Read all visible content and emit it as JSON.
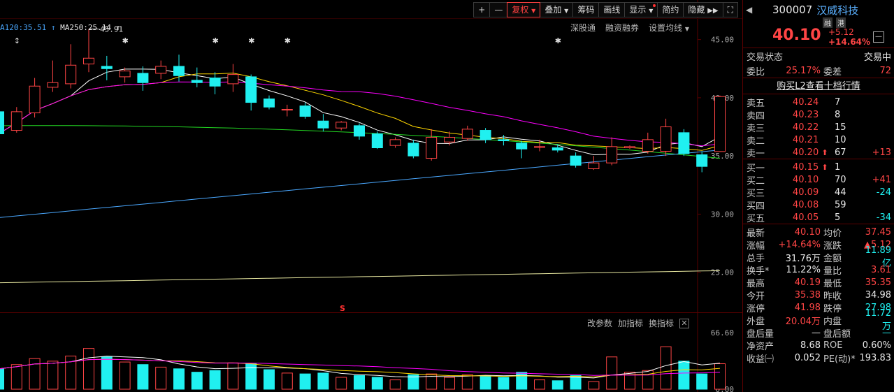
{
  "toolbar": {
    "plus": "+",
    "minus": "—",
    "fuquan": "复权",
    "diejia": "叠加",
    "chouma": "筹码",
    "huaxian": "画线",
    "xianshi": "显示",
    "jianyue": "简约",
    "yincang": "隐藏"
  },
  "ma_legend": {
    "ma120": "A120:35.51",
    "ma250": "MA250:25.14"
  },
  "sub_links": {
    "shengutong": "深股通",
    "rongzi": "融资融券",
    "settings": "设置均线"
  },
  "vol_links": {
    "gaicanshu": "改参数",
    "jiazhibiao": "加指标",
    "huanzhibiao": "换指标",
    "close": "✕"
  },
  "annotations": {
    "high_label": "45.91",
    "s_mark": "S"
  },
  "chart_data": {
    "type": "candlestick",
    "y_ticks": [
      "45.00",
      "40.00",
      "35.00",
      "30.00",
      "25.00"
    ],
    "vol_ticks": [
      "66.60",
      "0.00"
    ],
    "ylim": [
      21.5,
      48.4
    ],
    "vol_max": 66.6,
    "candles": [
      {
        "o": 38.8,
        "c": 36.9,
        "h": 39.0,
        "l": 36.6,
        "v": 24
      },
      {
        "o": 37.2,
        "c": 38.8,
        "h": 39.2,
        "l": 37.0,
        "v": 29
      },
      {
        "o": 38.7,
        "c": 41.0,
        "h": 41.7,
        "l": 38.3,
        "v": 36
      },
      {
        "o": 40.9,
        "c": 41.3,
        "h": 43.2,
        "l": 40.5,
        "v": 33
      },
      {
        "o": 41.2,
        "c": 42.8,
        "h": 44.6,
        "l": 40.8,
        "v": 39
      },
      {
        "o": 42.9,
        "c": 43.4,
        "h": 45.91,
        "l": 42.2,
        "v": 48
      },
      {
        "o": 42.7,
        "c": 42.5,
        "h": 43.6,
        "l": 41.5,
        "v": 38
      },
      {
        "o": 41.8,
        "c": 42.3,
        "h": 42.6,
        "l": 41.3,
        "v": 32
      },
      {
        "o": 42.1,
        "c": 41.3,
        "h": 42.7,
        "l": 40.6,
        "v": 29
      },
      {
        "o": 42.1,
        "c": 42.7,
        "h": 43.2,
        "l": 41.6,
        "v": 26
      },
      {
        "o": 42.7,
        "c": 41.9,
        "h": 43.7,
        "l": 41.4,
        "v": 24
      },
      {
        "o": 41.5,
        "c": 41.3,
        "h": 42.6,
        "l": 40.9,
        "v": 20
      },
      {
        "o": 41.7,
        "c": 41.0,
        "h": 42.2,
        "l": 40.3,
        "v": 22
      },
      {
        "o": 41.2,
        "c": 42.0,
        "h": 42.9,
        "l": 40.5,
        "v": 31
      },
      {
        "o": 41.8,
        "c": 39.6,
        "h": 42.0,
        "l": 38.9,
        "v": 30
      },
      {
        "o": 39.9,
        "c": 39.2,
        "h": 40.2,
        "l": 39.0,
        "v": 23
      },
      {
        "o": 39.0,
        "c": 39.0,
        "h": 39.4,
        "l": 38.4,
        "v": 19
      },
      {
        "o": 39.3,
        "c": 38.4,
        "h": 39.6,
        "l": 38.2,
        "v": 18
      },
      {
        "o": 38.0,
        "c": 37.4,
        "h": 38.6,
        "l": 37.1,
        "v": 19
      },
      {
        "o": 37.4,
        "c": 37.9,
        "h": 38.0,
        "l": 37.2,
        "v": 14
      },
      {
        "o": 37.6,
        "c": 36.7,
        "h": 37.8,
        "l": 36.4,
        "v": 16
      },
      {
        "o": 36.9,
        "c": 35.7,
        "h": 37.1,
        "l": 35.6,
        "v": 14
      },
      {
        "o": 35.9,
        "c": 36.4,
        "h": 36.6,
        "l": 35.7,
        "v": 11
      },
      {
        "o": 36.1,
        "c": 35.0,
        "h": 36.4,
        "l": 34.8,
        "v": 17
      },
      {
        "o": 34.8,
        "c": 36.6,
        "h": 37.3,
        "l": 34.6,
        "v": 18
      },
      {
        "o": 36.2,
        "c": 36.6,
        "h": 37.1,
        "l": 35.9,
        "v": 14
      },
      {
        "o": 36.5,
        "c": 37.3,
        "h": 37.6,
        "l": 36.3,
        "v": 17
      },
      {
        "o": 37.2,
        "c": 36.4,
        "h": 37.4,
        "l": 36.1,
        "v": 16
      },
      {
        "o": 36.4,
        "c": 36.3,
        "h": 36.8,
        "l": 35.9,
        "v": 14
      },
      {
        "o": 36.1,
        "c": 35.6,
        "h": 36.3,
        "l": 34.8,
        "v": 20
      },
      {
        "o": 35.8,
        "c": 35.8,
        "h": 36.4,
        "l": 35.4,
        "v": 11
      },
      {
        "o": 35.7,
        "c": 35.5,
        "h": 36.0,
        "l": 35.3,
        "v": 10
      },
      {
        "o": 35.0,
        "c": 34.2,
        "h": 35.3,
        "l": 34.0,
        "v": 16
      },
      {
        "o": 33.9,
        "c": 34.4,
        "h": 35.0,
        "l": 33.8,
        "v": 9
      },
      {
        "o": 34.4,
        "c": 35.8,
        "h": 36.6,
        "l": 34.2,
        "v": 38
      },
      {
        "o": 35.7,
        "c": 35.8,
        "h": 35.9,
        "l": 35.6,
        "v": 20
      },
      {
        "o": 35.4,
        "c": 36.4,
        "h": 37.0,
        "l": 35.2,
        "v": 22
      },
      {
        "o": 35.4,
        "c": 37.5,
        "h": 38.2,
        "l": 35.0,
        "v": 50
      },
      {
        "o": 37.0,
        "c": 35.2,
        "h": 37.3,
        "l": 35.0,
        "v": 33
      },
      {
        "o": 35.1,
        "c": 34.1,
        "h": 35.4,
        "l": 33.6,
        "v": 18
      },
      {
        "o": 35.38,
        "c": 40.1,
        "h": 40.19,
        "l": 35.35,
        "v": 30
      }
    ]
  },
  "quote": {
    "code": "300007",
    "name": "汉威科技",
    "tag1": "融",
    "tag2": "港",
    "price": "40.10",
    "change": "+5.12",
    "change_pct": "+14.64%",
    "minus_btn": "—",
    "trade_status_label": "交易状态",
    "trade_status_value": "交易中",
    "weibi_label": "委比",
    "weibi_value": "25.17%",
    "weicha_label": "委差",
    "weicha_value": "72",
    "l2_link": "购买L2查看十档行情",
    "asks": [
      {
        "label": "卖五",
        "price": "40.24",
        "vol": "7",
        "delta": ""
      },
      {
        "label": "卖四",
        "price": "40.23",
        "vol": "8",
        "delta": ""
      },
      {
        "label": "卖三",
        "price": "40.22",
        "vol": "15",
        "delta": ""
      },
      {
        "label": "卖二",
        "price": "40.21",
        "vol": "10",
        "delta": ""
      },
      {
        "label": "卖一",
        "price": "40.20",
        "arrow": "⬆",
        "vol": "67",
        "delta": "+13"
      }
    ],
    "bids": [
      {
        "label": "买一",
        "price": "40.15",
        "arrow": "⬆",
        "vol": "1",
        "delta": ""
      },
      {
        "label": "买二",
        "price": "40.10",
        "vol": "70",
        "delta": "+41"
      },
      {
        "label": "买三",
        "price": "40.09",
        "vol": "44",
        "delta": "-24"
      },
      {
        "label": "买四",
        "price": "40.08",
        "vol": "59",
        "delta": ""
      },
      {
        "label": "买五",
        "price": "40.05",
        "vol": "5",
        "delta": "-34"
      }
    ],
    "stats": [
      {
        "l1": "最新",
        "v1": "40.10",
        "c1": "red",
        "l2": "均价",
        "v2": "37.45",
        "c2": "red"
      },
      {
        "l1": "涨幅",
        "v1": "+14.64%",
        "c1": "red",
        "l2": "涨跌",
        "v2": "▲5.12",
        "c2": "red"
      },
      {
        "l1": "总手",
        "v1": "31.76万",
        "c1": "white",
        "l2": "金额",
        "v2": "11.89亿",
        "c2": "cyan"
      },
      {
        "l1": "换手*",
        "v1": "11.22%",
        "c1": "white",
        "l2": "量比",
        "v2": "3.61",
        "c2": "red"
      },
      {
        "l1": "最高",
        "v1": "40.19",
        "c1": "red",
        "l2": "最低",
        "v2": "35.35",
        "c2": "red"
      },
      {
        "l1": "今开",
        "v1": "35.38",
        "c1": "red",
        "l2": "昨收",
        "v2": "34.98",
        "c2": "white"
      },
      {
        "l1": "涨停",
        "v1": "41.98",
        "c1": "red",
        "l2": "跌停",
        "v2": "27.98",
        "c2": "cyan"
      },
      {
        "l1": "外盘",
        "v1": "20.04万",
        "c1": "red",
        "l2": "内盘",
        "v2": "11.72万",
        "c2": "cyan"
      },
      {
        "l1": "盘后量",
        "v1": "—",
        "c1": "white",
        "l2": "盘后额",
        "v2": "—",
        "c2": "cyan"
      },
      {
        "l1": "净资产",
        "v1": "8.68",
        "c1": "white",
        "l2": "ROE",
        "v2": "0.60%",
        "c2": "white"
      },
      {
        "l1": "收益㈠",
        "v1": "0.052",
        "c1": "white",
        "l2": "PE(动)*",
        "v2": "193.83",
        "c2": "white"
      }
    ]
  },
  "colors": {
    "up": "#ff4545",
    "down": "#20f0f0",
    "ma5": "#ffffff",
    "ma10": "#ffd700",
    "ma20": "#ff00ff",
    "ma60": "#22d722",
    "ma120": "#4aa8ff",
    "ma250": "#e8e8a0",
    "grid": "#5a0000"
  }
}
